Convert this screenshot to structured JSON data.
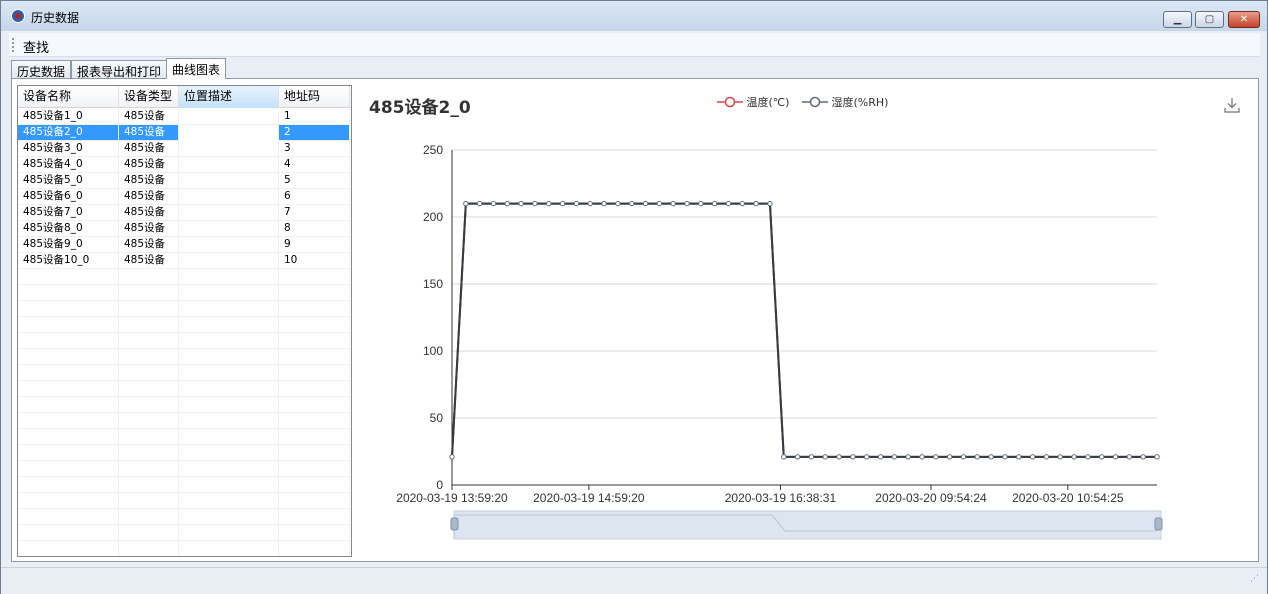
{
  "window": {
    "title": "历史数据"
  },
  "menu": {
    "find": "查找"
  },
  "tabs": [
    {
      "label": "历史数据"
    },
    {
      "label": "报表导出和打印"
    },
    {
      "label": "曲线图表"
    }
  ],
  "grid": {
    "headers": [
      "设备名称",
      "设备类型",
      "位置描述",
      "地址码"
    ],
    "rows": [
      {
        "name": "485设备1_0",
        "type": "485设备",
        "location": "",
        "address": "1"
      },
      {
        "name": "485设备2_0",
        "type": "485设备",
        "location": "",
        "address": "2"
      },
      {
        "name": "485设备3_0",
        "type": "485设备",
        "location": "",
        "address": "3"
      },
      {
        "name": "485设备4_0",
        "type": "485设备",
        "location": "",
        "address": "4"
      },
      {
        "name": "485设备5_0",
        "type": "485设备",
        "location": "",
        "address": "5"
      },
      {
        "name": "485设备6_0",
        "type": "485设备",
        "location": "",
        "address": "6"
      },
      {
        "name": "485设备7_0",
        "type": "485设备",
        "location": "",
        "address": "7"
      },
      {
        "name": "485设备8_0",
        "type": "485设备",
        "location": "",
        "address": "8"
      },
      {
        "name": "485设备9_0",
        "type": "485设备",
        "location": "",
        "address": "9"
      },
      {
        "name": "485设备10_0",
        "type": "485设备",
        "location": "",
        "address": "10"
      }
    ],
    "selected_index": 1
  },
  "icons": {
    "app": "app-logo-icon",
    "download": "download-icon",
    "minimize": "minimize-icon",
    "maximize": "maximize-icon",
    "close": "close-icon"
  },
  "colors": {
    "temperature": "#e0434b",
    "humidity": "#5b6b7c",
    "line": "#3a3a44",
    "selection": "#3399ff"
  },
  "chart_data": {
    "type": "line",
    "title": "485设备2_0",
    "x_ticks": [
      "2020-03-19 13:59:20",
      "2020-03-19 14:59:20",
      "2020-03-19 16:38:31",
      "2020-03-20 09:54:24",
      "2020-03-20 10:54:25"
    ],
    "ylim": [
      0,
      250
    ],
    "y_ticks": [
      0,
      50,
      100,
      150,
      200,
      250
    ],
    "grid": true,
    "legend_position": "top-center",
    "series": [
      {
        "name": "温度(℃)",
        "values": [
          21,
          210,
          210,
          210,
          210,
          210,
          210,
          210,
          210,
          210,
          210,
          210,
          210,
          210,
          210,
          210,
          210,
          210,
          210,
          210,
          210,
          210,
          210,
          210,
          21,
          21,
          21,
          21,
          21,
          21,
          21,
          21,
          21,
          21,
          21,
          21,
          21,
          21,
          21,
          21,
          21,
          21,
          21,
          21,
          21,
          21,
          21,
          21,
          21,
          21,
          21,
          21
        ]
      },
      {
        "name": "湿度(%RH)",
        "values": [
          21,
          210,
          210,
          210,
          210,
          210,
          210,
          210,
          210,
          210,
          210,
          210,
          210,
          210,
          210,
          210,
          210,
          210,
          210,
          210,
          210,
          210,
          210,
          210,
          21,
          21,
          21,
          21,
          21,
          21,
          21,
          21,
          21,
          21,
          21,
          21,
          21,
          21,
          21,
          21,
          21,
          21,
          21,
          21,
          21,
          21,
          21,
          21,
          21,
          21,
          21,
          21
        ]
      }
    ]
  }
}
